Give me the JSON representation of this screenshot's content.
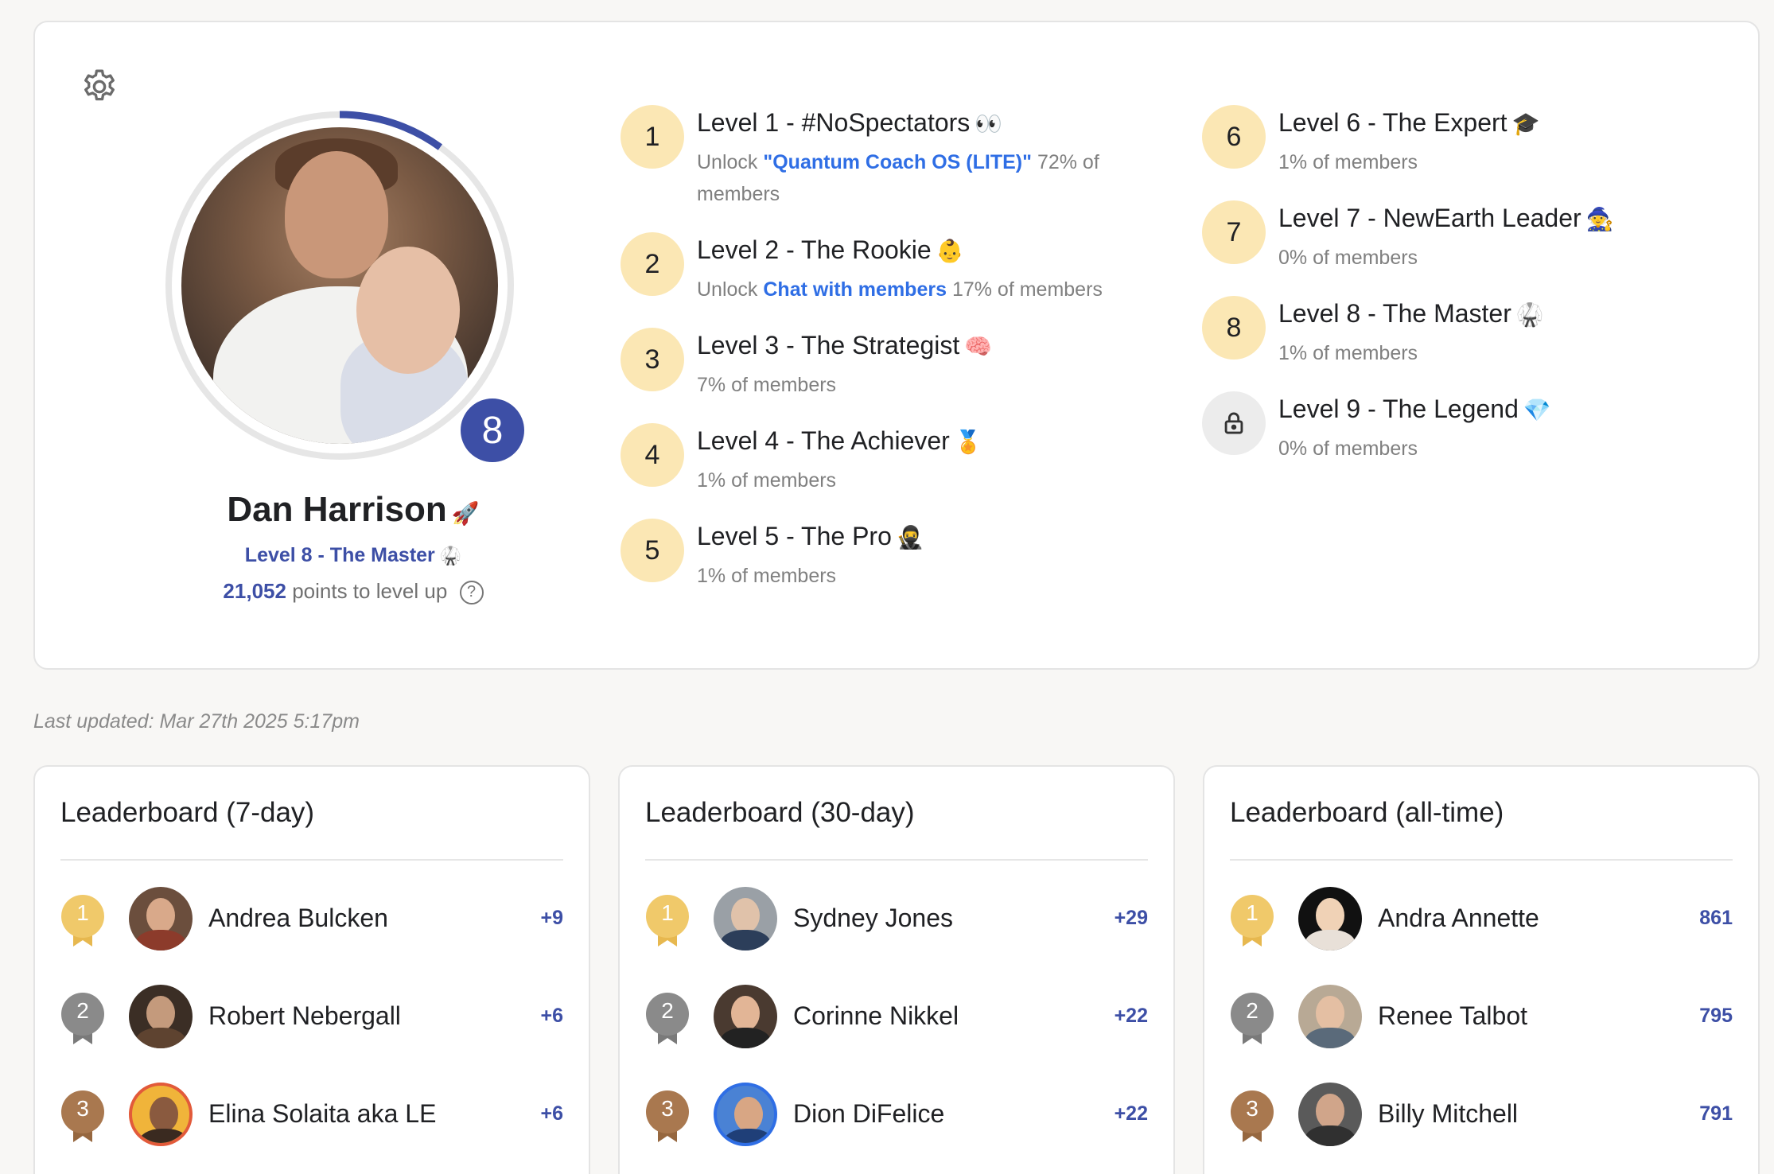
{
  "profile": {
    "name": "Dan Harrison",
    "name_emoji": "🚀",
    "level_number": "8",
    "level_label": "Level 8 - The Master",
    "level_emoji": "🥋",
    "points_to_level_up": "21,052",
    "points_suffix": "points to level up",
    "help_glyph": "?",
    "level_progress_fraction": 0.1
  },
  "levels": [
    {
      "number": "1",
      "title": "Level 1 - #NoSpectators",
      "emoji": "👀",
      "unlock_prefix": "Unlock ",
      "unlock_link": "\"Quantum Coach OS (LITE)\"",
      "members": "72% of members",
      "locked": false
    },
    {
      "number": "2",
      "title": "Level 2 - The Rookie",
      "emoji": "👶",
      "unlock_prefix": "Unlock ",
      "unlock_link": "Chat with members",
      "members": "17% of members",
      "locked": false
    },
    {
      "number": "3",
      "title": "Level 3 - The Strategist",
      "emoji": "🧠",
      "members": "7% of members",
      "locked": false
    },
    {
      "number": "4",
      "title": "Level 4 - The Achiever",
      "emoji": "🏅",
      "members": "1% of members",
      "locked": false
    },
    {
      "number": "5",
      "title": "Level 5 - The Pro",
      "emoji": "🥷",
      "members": "1% of members",
      "locked": false
    },
    {
      "number": "6",
      "title": "Level 6 - The Expert",
      "emoji": "🎓",
      "members": "1% of members",
      "locked": false
    },
    {
      "number": "7",
      "title": "Level 7 - NewEarth Leader",
      "emoji": "🧙",
      "members": "0% of members",
      "locked": false
    },
    {
      "number": "8",
      "title": "Level 8 - The Master",
      "emoji": "🥋",
      "members": "1% of members",
      "locked": false
    },
    {
      "number": "9",
      "title": "Level 9 - The Legend",
      "emoji": "💎",
      "members": "0% of members",
      "locked": true
    }
  ],
  "last_updated": "Last updated: Mar 27th 2025 5:17pm",
  "leaderboards": [
    {
      "title": "Leaderboard (7-day)",
      "rows": [
        {
          "rank": "1",
          "name": "Andrea Bulcken",
          "points": "+9"
        },
        {
          "rank": "2",
          "name": "Robert Nebergall",
          "points": "+6"
        },
        {
          "rank": "3",
          "name": "Elina Solaita aka LE",
          "points": "+6"
        }
      ]
    },
    {
      "title": "Leaderboard (30-day)",
      "rows": [
        {
          "rank": "1",
          "name": "Sydney Jones",
          "points": "+29"
        },
        {
          "rank": "2",
          "name": "Corinne Nikkel",
          "points": "+22"
        },
        {
          "rank": "3",
          "name": "Dion DiFelice",
          "points": "+22"
        }
      ]
    },
    {
      "title": "Leaderboard (all-time)",
      "rows": [
        {
          "rank": "1",
          "name": "Andra Annette",
          "points": "861"
        },
        {
          "rank": "2",
          "name": "Renee Talbot",
          "points": "795"
        },
        {
          "rank": "3",
          "name": "Billy Mitchell",
          "points": "791"
        }
      ]
    }
  ],
  "colors": {
    "accent": "#3d4fa6",
    "link": "#2f6ee5",
    "level_circle": "#fbe7b4",
    "gold": "#f0c96a",
    "silver": "#8a8a8a",
    "bronze": "#a9784f"
  },
  "icons": {
    "settings": "gear-icon",
    "lock": "lock-icon",
    "help": "question-circle-icon"
  }
}
